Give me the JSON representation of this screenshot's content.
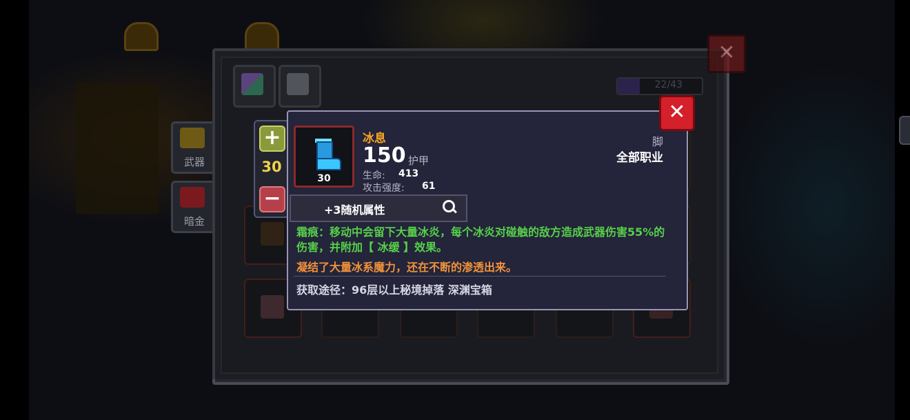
{
  "sidebar": {
    "weapon_label": "武器",
    "dark_gold_label": "暗金"
  },
  "inventory": {
    "capacity_text": "22/43",
    "capacity_fraction": 0.26
  },
  "level_stepper": {
    "plus_label": "+",
    "minus_label": "−",
    "value": "30"
  },
  "item": {
    "icon": "ice-boot-icon",
    "name": "冰息",
    "level": "30",
    "main_stat_value": "150",
    "main_stat_label": "护甲",
    "stats": [
      {
        "label": "生命:",
        "value": "413"
      },
      {
        "label": "攻击强度:",
        "value": "61"
      }
    ],
    "slot_type": "脚",
    "class_restriction": "全部职业",
    "random_attributes": "+3随机属性",
    "effect_text": "霜痕：移动中会留下大量冰炎，每个冰炎对碰触的敌方造成武器伤害55%的伤害，并附加【 冰缓 】效果。",
    "flavor_text": "凝结了大量冰系魔力，还在不断的渗透出来。",
    "source_text": "获取途径：96层以上秘境掉落 深渊宝箱",
    "colors": {
      "name": "#f6a623",
      "effect": "#56d04a",
      "flavor": "#f0923a"
    }
  },
  "buttons": {
    "close_label": "✕"
  }
}
